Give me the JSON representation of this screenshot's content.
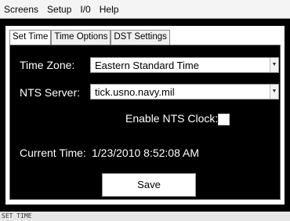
{
  "menu": [
    "Screens",
    "Setup",
    "I/0",
    "Help"
  ],
  "tabs": [
    "Set Time",
    "Time Options",
    "DST Settings"
  ],
  "form": {
    "time_zone_label": "Time Zone:",
    "time_zone_value": "Eastern Standard Time",
    "nts_server_label": "NTS Server:",
    "nts_server_value": "tick.usno.navy.mil",
    "enable_nts_label": "Enable NTS Clock:",
    "current_time_label": "Current Time:",
    "current_time_value": "1/23/2010 8:52:08 AM",
    "save_label": "Save"
  },
  "status": "SET TIME",
  "icons": {
    "dropdown": "dropdown-arrow-icon"
  },
  "colors": {
    "panel": "#000000",
    "menubar": "#f4f4f4",
    "status": "#e6e6e6"
  }
}
